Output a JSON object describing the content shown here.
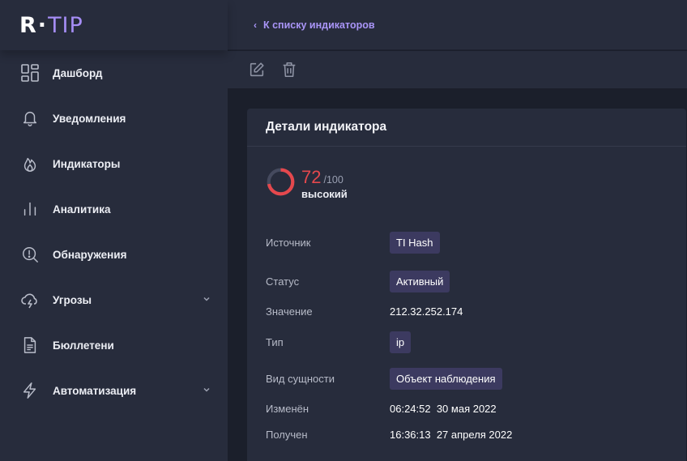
{
  "brand": {
    "left": "R",
    "sep": "·",
    "right": "TIP",
    "accent": "#a58df5"
  },
  "sidebar": {
    "items": [
      {
        "label": "Дашборд",
        "icon": "dashboard-icon"
      },
      {
        "label": "Уведомления",
        "icon": "bell-icon"
      },
      {
        "label": "Индикаторы",
        "icon": "flame-icon"
      },
      {
        "label": "Аналитика",
        "icon": "bar-chart-icon"
      },
      {
        "label": "Обнаружения",
        "icon": "search-alert-icon"
      },
      {
        "label": "Угрозы",
        "icon": "storm-cloud-icon",
        "expandable": true
      },
      {
        "label": "Бюллетени",
        "icon": "document-icon"
      },
      {
        "label": "Автоматизация",
        "icon": "lightning-icon",
        "expandable": true
      }
    ]
  },
  "topbar": {
    "back_label": "К списку индикаторов"
  },
  "toolbar": {
    "edit_icon": "edit-icon",
    "delete_icon": "trash-icon"
  },
  "card": {
    "title": "Детали индикатора",
    "score": {
      "value": "72",
      "max": "/100",
      "level": "высокий",
      "fraction": 0.72,
      "color": "#e5484d"
    },
    "fields": {
      "source": {
        "key": "Источник",
        "value": "TI Hash"
      },
      "status": {
        "key": "Статус",
        "value": "Активный"
      },
      "value": {
        "key": "Значение",
        "value": "212.32.252.174"
      },
      "type": {
        "key": "Тип",
        "value": "ip"
      },
      "entity": {
        "key": "Вид сущности",
        "value": "Объект наблюдения"
      },
      "modified": {
        "key": "Изменён",
        "value": "06:24:52  30 мая 2022"
      },
      "received": {
        "key": "Получен",
        "value": "16:36:13  27 апреля 2022"
      }
    }
  }
}
